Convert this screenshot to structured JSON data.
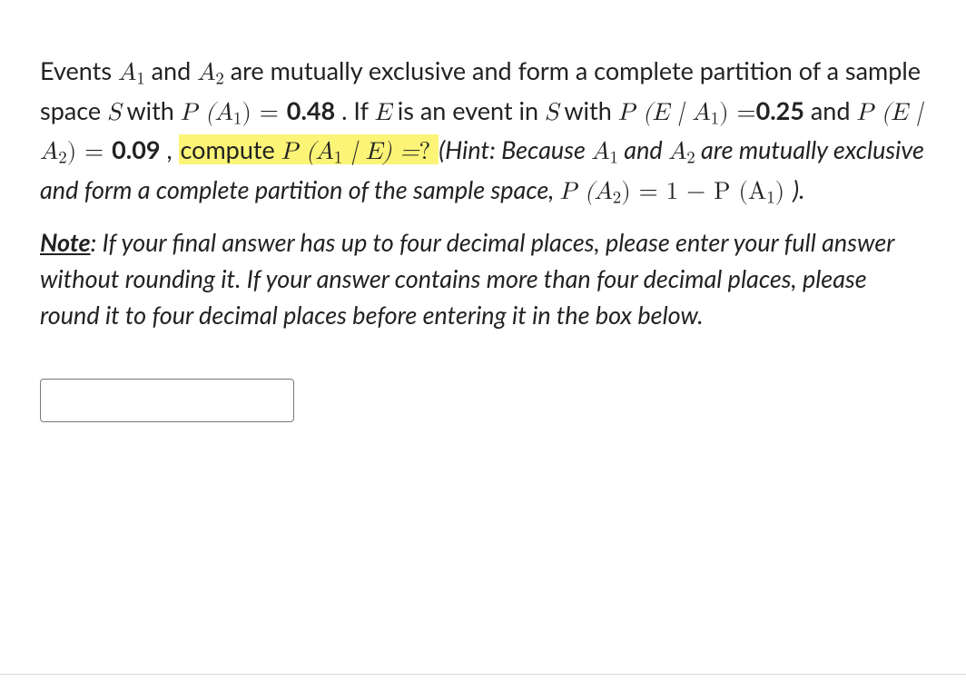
{
  "problem": {
    "t1": "Events ",
    "A1": "A",
    "sub1": "1",
    "t2": " and ",
    "A2": "A",
    "sub2": "2",
    "t3": " are mutually exclusive and form a complete partition of a sample space ",
    "S": "S",
    "t4": " with ",
    "PA1_lhs": "P (A",
    "PA1_sub": "1",
    "PA1_rhs": ") = ",
    "PA1_val": "0.48",
    "t5": ". If ",
    "E": "E",
    "t6": " is an event in ",
    "S2": "S",
    "t7": " with ",
    "PE_A1_lhs": "P (E | A",
    "PE_A1_sub": "1",
    "PE_A1_rhs": ") =",
    "PE_A1_val": "0.25",
    "t8": " and ",
    "PE_A2_lhs": "P (E | A",
    "PE_A2_sub": "2",
    "PE_A2_rhs": ") = ",
    "PE_A2_val": "0.09",
    "t9": " , ",
    "hl_pre": "compute ",
    "hl_lhs": "P (A",
    "hl_sub": "1",
    "hl_mid": " | E) =",
    "hl_q": "?",
    "hint_open": " (Hint: Because ",
    "hint_A1": "A",
    "hint_sub1": "1",
    "hint_and": " and ",
    "hint_A2": "A",
    "hint_sub2": "2",
    "hint_mid": " are mutually exclusive and form a complete partition of the sample space, ",
    "hint_eq_l": "P (A",
    "hint_eq_sub2": "2",
    "hint_eq_mid": ") = 1 − P (A",
    "hint_eq_sub1": "1",
    "hint_eq_r": ") ",
    "hint_close": ")."
  },
  "note": {
    "label": "Note",
    "colon": ": ",
    "body": "If your final answer has up to four decimal places, please enter your full answer without rounding it. If your answer contains more than four decimal places, please round it to four decimal places before entering it in the box below."
  },
  "answer": {
    "placeholder": ""
  }
}
